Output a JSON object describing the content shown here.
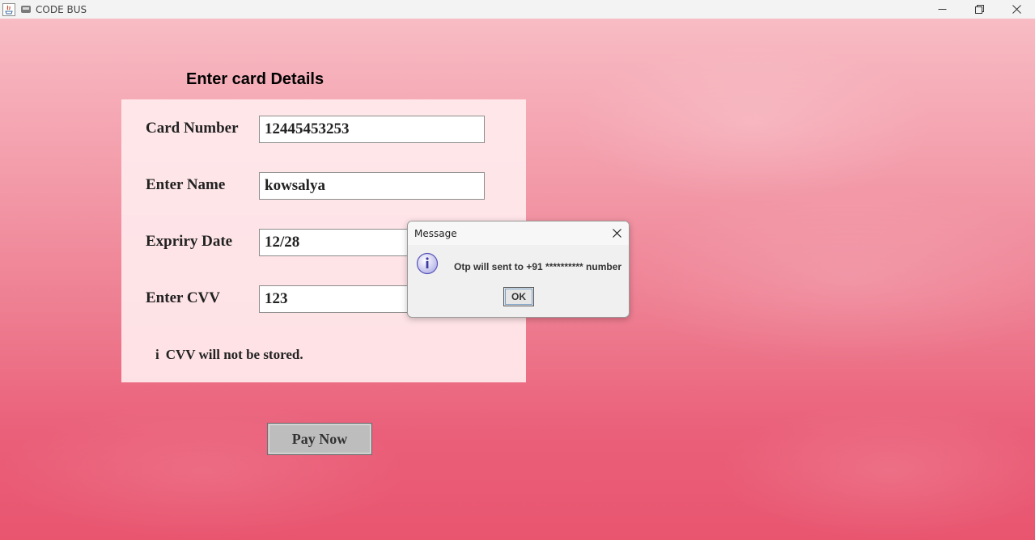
{
  "window": {
    "title": "CODE BUS",
    "icons": {
      "app": "java-icon",
      "title": "bus-icon",
      "controls": [
        "minimize-icon",
        "restore-icon",
        "close-icon"
      ]
    }
  },
  "form": {
    "heading": "Enter card Details",
    "fields": [
      {
        "label": "Card Number",
        "value": "12445453253"
      },
      {
        "label": "Enter Name",
        "value": "kowsalya"
      },
      {
        "label": "Expriry Date",
        "value": "12/28"
      },
      {
        "label": "Enter CVV",
        "value": "123"
      }
    ],
    "note_icon": "i",
    "note": "CVV will not be stored.",
    "pay_button": "Pay Now"
  },
  "dialog": {
    "title": "Message",
    "message": "Otp will sent to +91 ********** number",
    "ok_button": "OK",
    "icon": "info-icon"
  },
  "colors": {
    "background_top": "#f8bcc4",
    "background_bottom": "#e9556f",
    "panel": "#ffebee",
    "button": "#bdbdbd"
  }
}
